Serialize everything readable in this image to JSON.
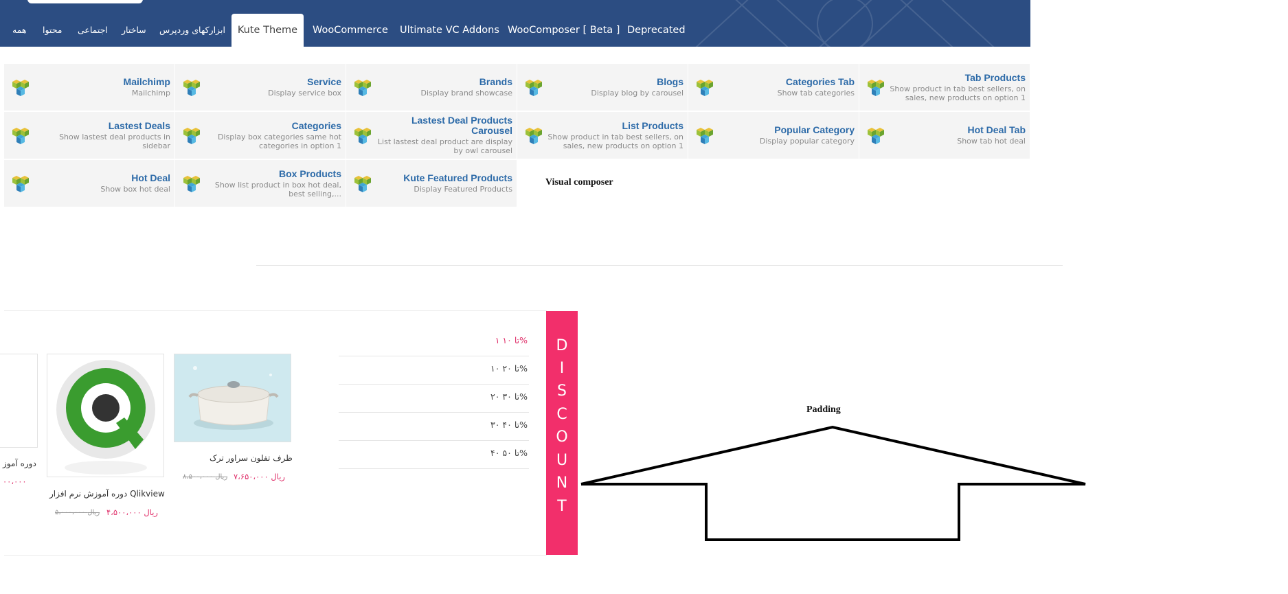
{
  "topbar": {
    "tabs": [
      {
        "label": "همه"
      },
      {
        "label": "محتوا"
      },
      {
        "label": "اجتماعی"
      },
      {
        "label": "ساختار"
      },
      {
        "label": "ابزارکهای وردپرس"
      },
      {
        "label": "Kute Theme",
        "active": true
      },
      {
        "label": "WooCommerce"
      },
      {
        "label": "Ultimate VC Addons"
      },
      {
        "label": "WooComposer [ Beta ]"
      },
      {
        "label": "Deprecated"
      }
    ],
    "bg_color": "#2c4d82"
  },
  "elements": [
    {
      "title": "Mailchimp",
      "desc": "Mailchimp"
    },
    {
      "title": "Service",
      "desc": "Display service box"
    },
    {
      "title": "Brands",
      "desc": "Display brand showcase"
    },
    {
      "title": "Blogs",
      "desc": "Display blog by carousel"
    },
    {
      "title": "Categories Tab",
      "desc": "Show tab categories"
    },
    {
      "title": "Tab Products",
      "desc": "Show product in tab best sellers, on sales, new products on option 1"
    },
    {
      "title": "Lastest Deals",
      "desc": "Show lastest deal products in sidebar"
    },
    {
      "title": "Categories",
      "desc": "Display box categories same hot categories in option 1"
    },
    {
      "title": "Lastest Deal Products Carousel",
      "desc": "List lastest deal product are display by owl carousel"
    },
    {
      "title": "List Products",
      "desc": "Show product in tab best sellers, on sales, new products on option 1"
    },
    {
      "title": "Popular Category",
      "desc": "Display popular category"
    },
    {
      "title": "Hot Deal Tab",
      "desc": "Show tab hot deal"
    },
    {
      "title": "Hot Deal",
      "desc": "Show box hot deal"
    },
    {
      "title": "Box Products",
      "desc": "Show list product in box hot deal, best selling,..."
    },
    {
      "title": "Kute Featured Products",
      "desc": "Display Featured Products"
    }
  ],
  "labels": {
    "visual_composer": "Visual composer",
    "padding": "Padding"
  },
  "discount": {
    "letters": [
      "D",
      "I",
      "S",
      "C",
      "O",
      "U",
      "N",
      "T"
    ],
    "color": "#f22f6b",
    "ranges": [
      "۱ تا ۱۰%",
      "۱۰ تا ۲۰%",
      "۲۰ تا ۳۰%",
      "۳۰ تا ۴۰%",
      "۴۰ تا ۵۰%"
    ]
  },
  "products": [
    {
      "name": "ظرف تفلون سراور ترک",
      "price_new": "۷،۶۵۰،۰۰۰ ریال",
      "price_old": "۸،۵۰۰،۰۰۰ ریال"
    },
    {
      "name": "دوره آموزش نرم افزار Qlikview",
      "price_new": "۴،۵۰۰،۰۰۰ ریال",
      "price_old": "۵،۰۰۰،۰۰۰ ریال"
    },
    {
      "name": "دوره آموز",
      "price_new": "۰۰،۰۰۰"
    }
  ]
}
